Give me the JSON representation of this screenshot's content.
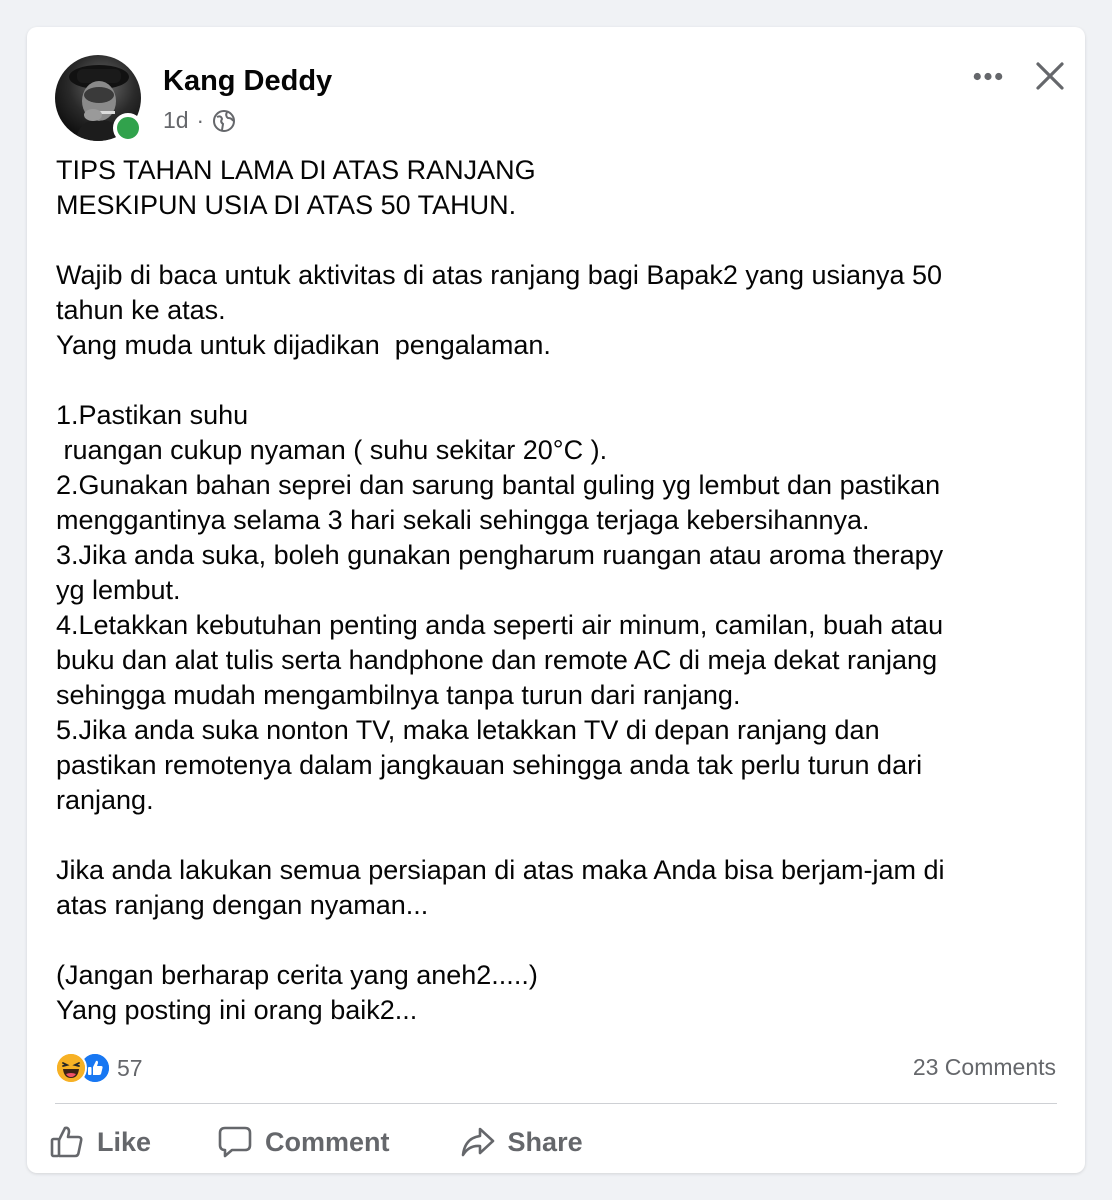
{
  "post": {
    "author": "Kang Deddy",
    "time": "1d",
    "separator": "·",
    "text": "TIPS TAHAN LAMA DI ATAS RANJANG\nMESKIPUN USIA DI ATAS 50 TAHUN.\n\nWajib di baca untuk aktivitas di atas ranjang bagi Bapak2 yang usianya 50\ntahun ke atas.\nYang muda untuk dijadikan  pengalaman.\n\n1.Pastikan suhu\n ruangan cukup nyaman ( suhu sekitar 20°C ).\n2.Gunakan bahan seprei dan sarung bantal guling yg lembut dan pastikan\nmenggantinya selama 3 hari sekali sehingga terjaga kebersihannya.\n3.Jika anda suka, boleh gunakan pengharum ruangan atau aroma therapy\nyg lembut.\n4.Letakkan kebutuhan penting anda seperti air minum, camilan, buah atau\nbuku dan alat tulis serta handphone dan remote AC di meja dekat ranjang\nsehingga mudah mengambilnya tanpa turun dari ranjang.\n5.Jika anda suka nonton TV, maka letakkan TV di depan ranjang dan\npastikan remotenya dalam jangkauan sehingga anda tak perlu turun dari\nranjang.\n\nJika anda lakukan semua persiapan di atas maka Anda bisa berjam-jam di\natas ranjang dengan nyaman...\n\n(Jangan berharap cerita yang aneh2.....)\nYang posting ini orang baik2...",
    "reaction_icons": [
      "haha-icon",
      "like-reaction-icon"
    ],
    "reaction_count": "57",
    "comments_count": "23 Comments"
  },
  "actions": {
    "like_label": "Like",
    "comment_label": "Comment",
    "share_label": "Share"
  },
  "colors": {
    "online": "#31a24c",
    "like_blue": "#1877f2",
    "haha_yellow": "#f7b125",
    "secondary_text": "#65676b"
  }
}
